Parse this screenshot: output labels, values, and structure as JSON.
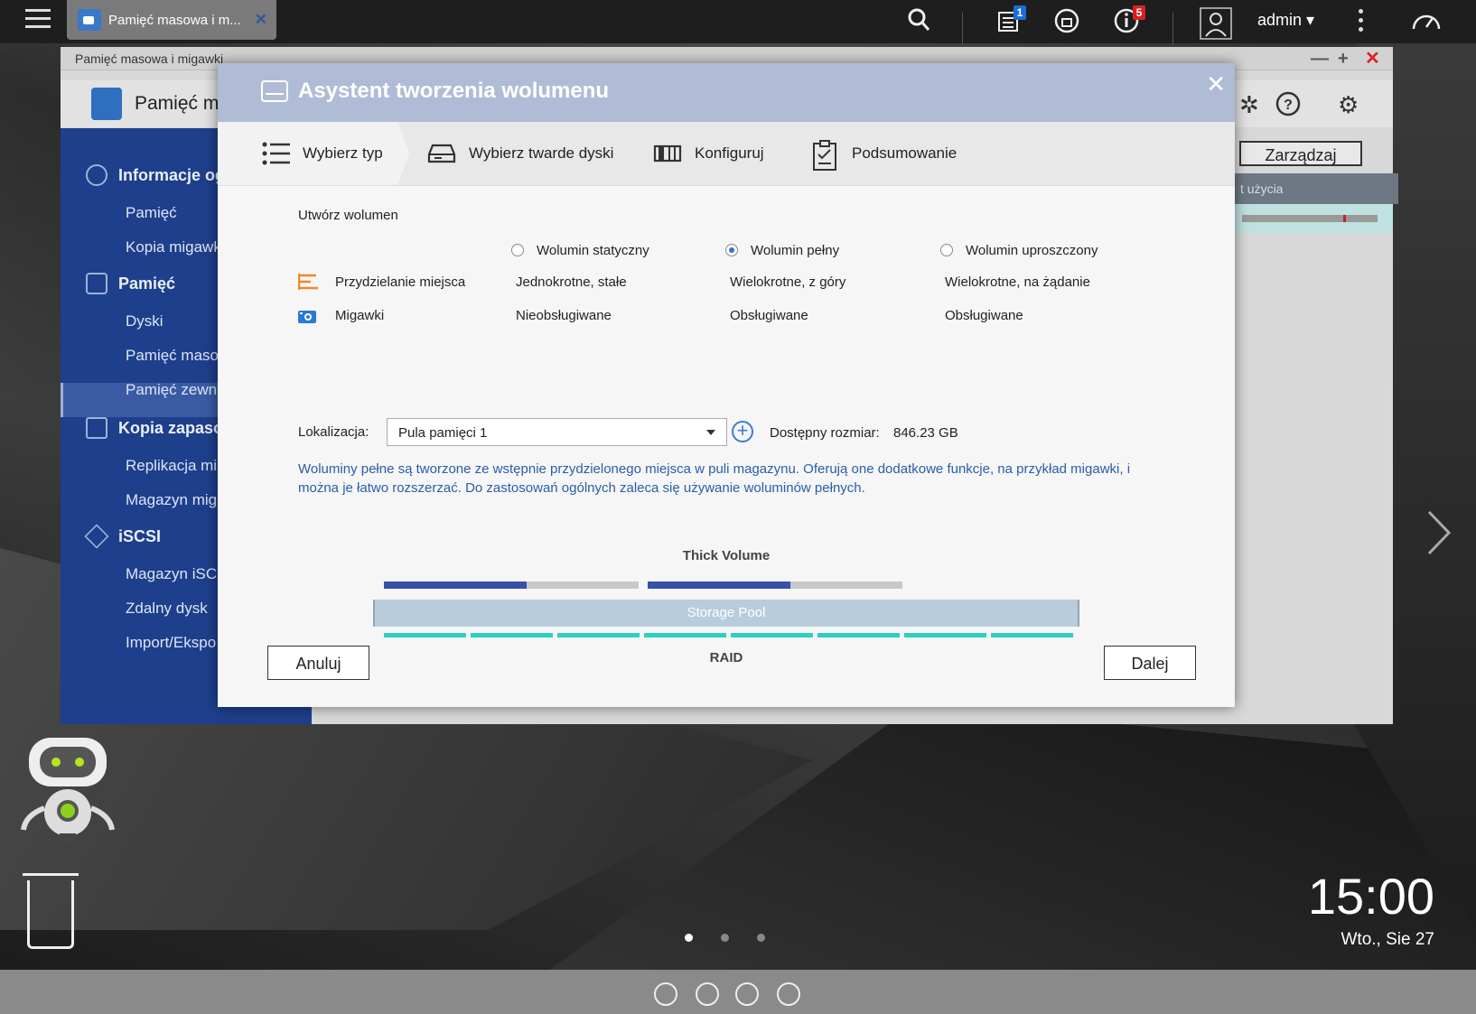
{
  "topbar": {
    "app_tab_label": "Pamięć masowa i m...",
    "user": "admin",
    "badge_tasks": "1",
    "badge_notifications": "5"
  },
  "app": {
    "window_title": "Pamięć masowa i migawki",
    "header_title": "Pamięć m",
    "manage_button": "Zarządzaj",
    "usage_header": "t użycia",
    "sidebar": {
      "sec_overview": "Informacje og",
      "item_storage": "Pamięć",
      "item_snapshot_backup": "Kopia migawk",
      "sec_storage": "Pamięć",
      "item_disks": "Dyski",
      "item_storage_snapshots": "Pamięć maso",
      "item_external": "Pamięć zewne",
      "sec_backup": "Kopia zapaso",
      "item_replication": "Replikacja mi",
      "item_vault": "Magazyn miga",
      "sec_iscsi": "iSCSI",
      "item_iscsi_storage": "Magazyn iSCS",
      "item_remote_disk": "Zdalny dysk",
      "item_import": "Import/Ekspo"
    }
  },
  "modal": {
    "title": "Asystent tworzenia wolumenu",
    "steps": [
      "Wybierz typ",
      "Wybierz twarde dyski",
      "Konfiguruj",
      "Podsumowanie"
    ],
    "section_title": "Utwórz wolumen",
    "volume_types": [
      "Wolumin statyczny",
      "Wolumin pełny",
      "Wolumin uproszczony"
    ],
    "selected_type": "Wolumin pełny",
    "rows": [
      {
        "label": "Przydzielanie miejsca",
        "values": [
          "Jednokrotne, stałe",
          "Wielokrotne, z góry",
          "Wielokrotne, na żądanie"
        ]
      },
      {
        "label": "Migawki",
        "values": [
          "Nieobsługiwane",
          "Obsługiwane",
          "Obsługiwane"
        ]
      }
    ],
    "location_label": "Lokalizacja:",
    "location_value": "Pula pamięci 1",
    "available_label": "Dostępny rozmiar:",
    "available_value": "846.23 GB",
    "description": "Woluminy pełne są tworzone ze wstępnie przydzielonego miejsca w puli magazynu. Oferują one dodatkowe funkcje, na przykład migawki, i można je łatwo rozszerzać. Do zastosowań ogólnych zaleca się używanie woluminów pełnych.",
    "diagram": {
      "title": "Thick Volume",
      "pool_label": "Storage Pool",
      "raid_label": "RAID",
      "volume_fill": [
        0.56,
        0.56
      ]
    },
    "cancel": "Anuluj",
    "next": "Dalej"
  },
  "desktop": {
    "time": "15:00",
    "date": "Wto., Sie 27"
  },
  "colors": {
    "sidebar": "#1e3f8c",
    "modal_header": "#b0bcd6",
    "accent_blue": "#3b6bd6",
    "raid_teal": "#2fcfbf",
    "badge_blue": "#1a6fd6",
    "badge_red": "#d92121"
  }
}
